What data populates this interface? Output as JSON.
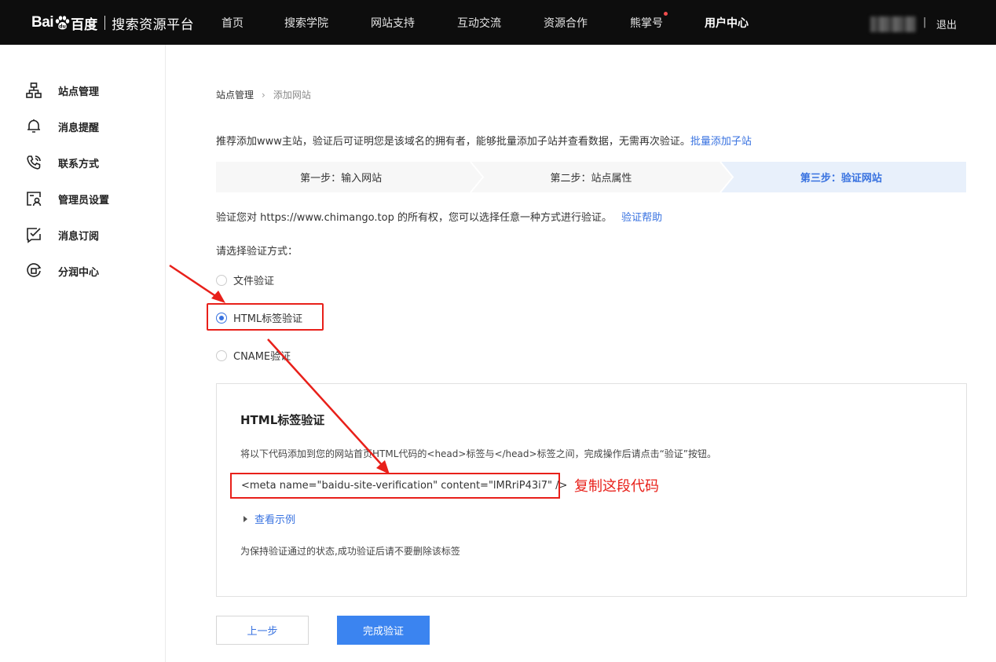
{
  "colors": {
    "accent": "#3872e0",
    "annotation": "#e8201a",
    "topbar": "#0d0d0d",
    "nav_dot": "#f24d4d"
  },
  "header": {
    "logo_text": "Bai百度",
    "logo_bai": "Bai",
    "logo_du": "百度",
    "platform": "搜索资源平台",
    "nav": [
      "首页",
      "搜索学院",
      "网站支持",
      "互动交流",
      "资源合作",
      "熊掌号",
      "用户中心"
    ],
    "active_nav": "用户中心",
    "separator": "|",
    "logout": "退出"
  },
  "sidebar": {
    "items": [
      {
        "label": "站点管理",
        "icon": "sitemap-icon"
      },
      {
        "label": "消息提醒",
        "icon": "bell-icon"
      },
      {
        "label": "联系方式",
        "icon": "phone-icon"
      },
      {
        "label": "管理员设置",
        "icon": "admin-card-icon"
      },
      {
        "label": "消息订阅",
        "icon": "subscribe-check-icon"
      },
      {
        "label": "分润中心",
        "icon": "revenue-coin-icon"
      }
    ]
  },
  "breadcrumb": {
    "parent": "站点管理",
    "current": "添加网站"
  },
  "intro": {
    "text": "推荐添加www主站，验证后可证明您是该域名的拥有者，能够批量添加子站并查看数据，无需再次验证。",
    "link": "批量添加子站"
  },
  "steps": [
    "第一步：输入网站",
    "第二步：站点属性",
    "第三步：验证网站"
  ],
  "active_step": 2,
  "verify": {
    "text": "验证您对 https://www.chimango.top 的所有权，您可以选择任意一种方式进行验证。",
    "help_link": "验证帮助"
  },
  "choose_label": "请选择验证方式：",
  "methods": [
    {
      "label": "文件验证",
      "selected": false
    },
    {
      "label": "HTML标签验证",
      "selected": true
    },
    {
      "label": "CNAME验证",
      "selected": false
    }
  ],
  "panel": {
    "title": "HTML标签验证",
    "desc": "将以下代码添加到您的网站首页HTML代码的<head>标签与</head>标签之间，完成操作后请点击“验证”按钮。",
    "code": "<meta name=\"baidu-site-verification\" content=\"lMRriP43i7\" />",
    "example_link": "查看示例",
    "keep_note": "为保持验证通过的状态,成功验证后请不要删除该标签"
  },
  "annotation": {
    "copy_note": "复制这段代码"
  },
  "buttons": {
    "prev": "上一步",
    "done": "完成验证"
  }
}
